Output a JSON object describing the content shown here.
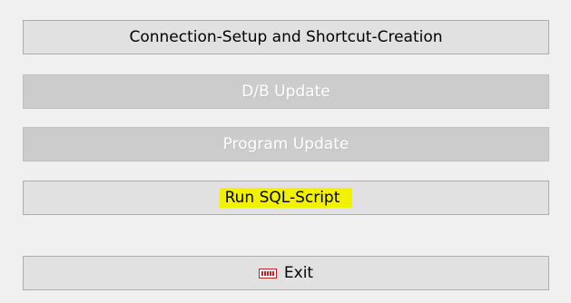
{
  "buttons": {
    "connection_setup": {
      "label": "Connection-Setup and Shortcut-Creation",
      "enabled": true
    },
    "db_update": {
      "label": "D/B Update",
      "enabled": false
    },
    "program_update": {
      "label": "Program Update",
      "enabled": false
    },
    "run_sql_script": {
      "label": "Run SQL-Script",
      "enabled": true,
      "highlight_color": "#f2f200"
    },
    "exit": {
      "label": "Exit",
      "icon": "exit-icon",
      "icon_color": "#c0212b",
      "enabled": true
    }
  },
  "colors": {
    "background": "#f0f0f0",
    "button_face": "#e1e1e1",
    "button_border": "#adadad",
    "disabled_face": "#cccccc",
    "disabled_text": "#ffffff"
  }
}
